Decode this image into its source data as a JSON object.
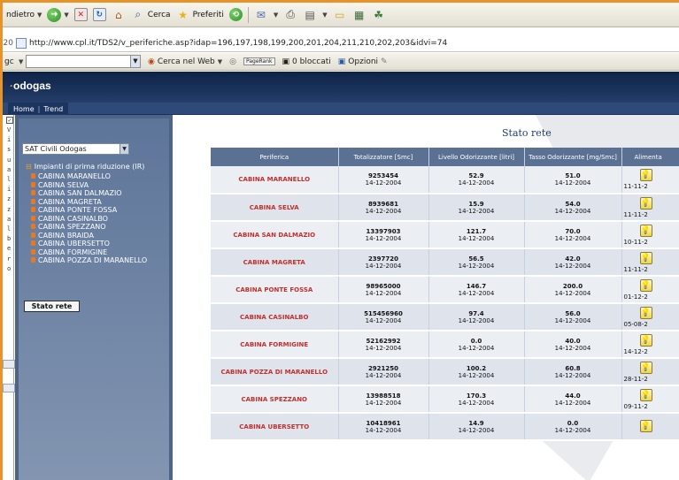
{
  "browser": {
    "toolbar": {
      "back_label": "ndietro",
      "search_label": "Cerca",
      "favorites_label": "Preferiti"
    },
    "address": {
      "line_number": "20",
      "url": "http://www.cpl.it/TDS2/v_periferiche.asp?idap=196,197,198,199,200,201,204,211,210,202,203&idvi=74"
    },
    "search_toolbar": {
      "left_label": "gc",
      "web_search_label": "Cerca nel Web",
      "pagerank_label": "PageRank",
      "blocked_label": "0 bloccati",
      "options_label": "Opzioni"
    }
  },
  "site": {
    "logo": "odogas",
    "nav": [
      "Home",
      "Trend"
    ]
  },
  "sidebar": {
    "vertical_label": "Visualizzalbero",
    "select_value": "SAT Civili Odogas",
    "root_label": "Impianti di prima riduzione (IR)",
    "items": [
      "CABINA MARANELLO",
      "CABINA SELVA",
      "CABINA SAN DALMAZIO",
      "CABINA MAGRETA",
      "CABINA PONTE FOSSA",
      "CABINA CASINALBO",
      "CABINA SPEZZANO",
      "CABINA BRAIDA",
      "CABINA UBERSETTO",
      "CABINA FORMIGINE",
      "CABINA POZZA DI MARANELLO"
    ],
    "button_label": "Stato rete"
  },
  "main": {
    "title": "Stato rete",
    "headers": [
      "Periferica",
      "Totalizzatore [Smc]",
      "Livello Odorizzante [litri]",
      "Tasso Odorizzante [mg/Smc]",
      "Alimenta"
    ],
    "rows": [
      {
        "name": "CABINA MARANELLO",
        "tot": "9253454",
        "tot_date": "14-12-2004",
        "liv": "52.9",
        "liv_date": "14-12-2004",
        "tasso": "51.0",
        "tasso_date": "14-12-2004",
        "alim_date": "11-11-2"
      },
      {
        "name": "CABINA SELVA",
        "tot": "8939681",
        "tot_date": "14-12-2004",
        "liv": "15.9",
        "liv_date": "14-12-2004",
        "tasso": "54.0",
        "tasso_date": "14-12-2004",
        "alim_date": "11-11-2"
      },
      {
        "name": "CABINA SAN DALMAZIO",
        "tot": "13397903",
        "tot_date": "14-12-2004",
        "liv": "121.7",
        "liv_date": "14-12-2004",
        "tasso": "70.0",
        "tasso_date": "14-12-2004",
        "alim_date": "10-11-2"
      },
      {
        "name": "CABINA MAGRETA",
        "tot": "2397720",
        "tot_date": "14-12-2004",
        "liv": "56.5",
        "liv_date": "14-12-2004",
        "tasso": "42.0",
        "tasso_date": "14-12-2004",
        "alim_date": "11-11-2"
      },
      {
        "name": "CABINA PONTE FOSSA",
        "tot": "98965000",
        "tot_date": "14-12-2004",
        "liv": "146.7",
        "liv_date": "14-12-2004",
        "tasso": "200.0",
        "tasso_date": "14-12-2004",
        "alim_date": "01-12-2"
      },
      {
        "name": "CABINA CASINALBO",
        "tot": "515456960",
        "tot_date": "14-12-2004",
        "liv": "97.4",
        "liv_date": "14-12-2004",
        "tasso": "56.0",
        "tasso_date": "14-12-2004",
        "alim_date": "05-08-2"
      },
      {
        "name": "CABINA FORMIGINE",
        "tot": "52162992",
        "tot_date": "14-12-2004",
        "liv": "0.0",
        "liv_date": "14-12-2004",
        "tasso": "40.0",
        "tasso_date": "14-12-2004",
        "alim_date": "14-12-2"
      },
      {
        "name": "CABINA POZZA DI MARANELLO",
        "tot": "2921250",
        "tot_date": "14-12-2004",
        "liv": "100.2",
        "liv_date": "14-12-2004",
        "tasso": "60.8",
        "tasso_date": "14-12-2004",
        "alim_date": "28-11-2"
      },
      {
        "name": "CABINA SPEZZANO",
        "tot": "13988518",
        "tot_date": "14-12-2004",
        "liv": "170.3",
        "liv_date": "14-12-2004",
        "tasso": "44.0",
        "tasso_date": "14-12-2004",
        "alim_date": "09-11-2"
      },
      {
        "name": "CABINA UBERSETTO",
        "tot": "10418961",
        "tot_date": "14-12-2004",
        "liv": "14.9",
        "liv_date": "14-12-2004",
        "tasso": "0.0",
        "tasso_date": "14-12-2004",
        "alim_date": ""
      }
    ]
  },
  "colors": {
    "accent_orange": "#e8922a",
    "header_blue": "#243e69",
    "row_name_red": "#c0312e",
    "table_header": "#5a7193"
  },
  "icons": [
    "back-arrow-icon",
    "forward-arrow-icon",
    "stop-icon",
    "refresh-icon",
    "home-icon",
    "search-icon",
    "favorites-star-icon",
    "history-icon",
    "mail-icon",
    "print-icon",
    "edit-icon",
    "folder-icon",
    "lightbulb-icon"
  ]
}
